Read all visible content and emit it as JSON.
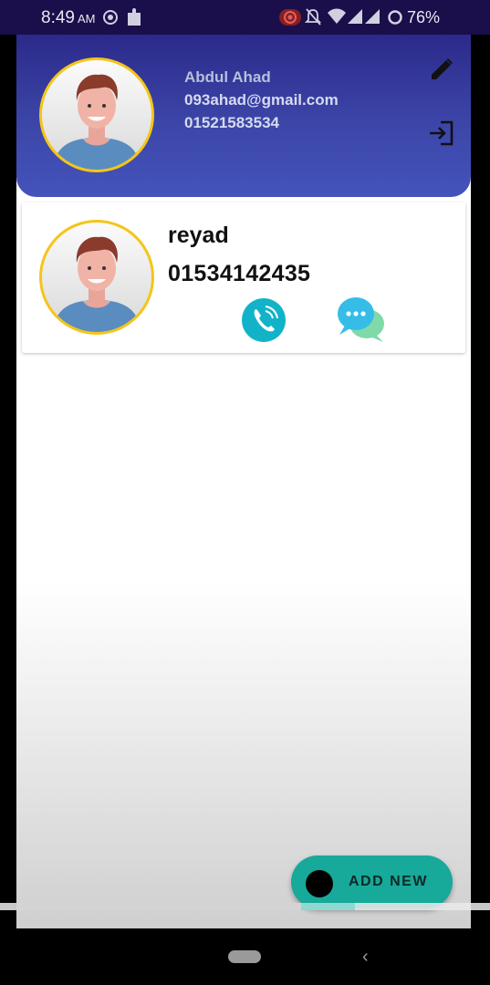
{
  "status_bar": {
    "time": "8:49",
    "ampm": "AM",
    "battery": "76%",
    "icons": [
      "screen-record-icon",
      "puzzle-icon",
      "record-badge-icon",
      "bell-off-icon",
      "wifi-icon",
      "signal-icon",
      "signal-icon",
      "battery-ring-icon"
    ]
  },
  "header": {
    "name": "Abdul Ahad",
    "email": "093ahad@gmail.com",
    "phone": "01521583534",
    "edit_icon": "pencil-icon",
    "logout_icon": "login-icon"
  },
  "contacts": [
    {
      "name": "reyad",
      "phone": "01534142435",
      "call_icon": "phone-call-icon",
      "message_icon": "chat-bubbles-icon"
    }
  ],
  "fab": {
    "label": "ADD NEW"
  },
  "colors": {
    "header_top": "#2b2a8a",
    "header_bottom": "#4453bb",
    "avatar_ring": "#f5c518",
    "fab": "#17a99a",
    "call": "#12b3c9"
  }
}
